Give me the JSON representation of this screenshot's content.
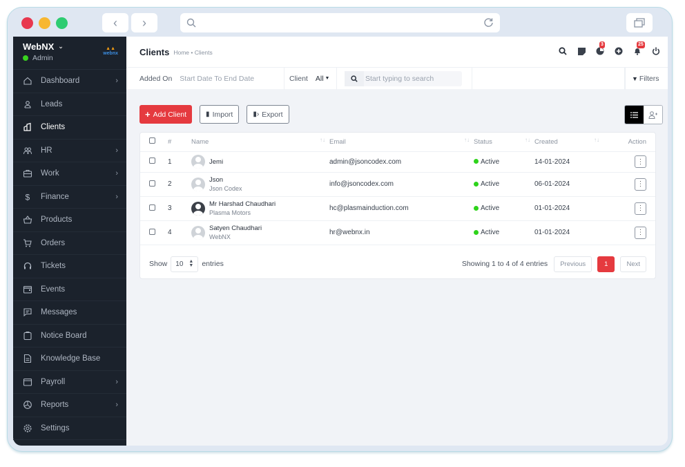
{
  "window": {
    "traffic_lights": {
      "close": "#e8384f",
      "minimize": "#f7b731",
      "maximize": "#2ecc71"
    }
  },
  "sidebar": {
    "brand": "WebNX",
    "role": "Admin",
    "logo_text": "webnx",
    "items": [
      {
        "label": "Dashboard",
        "icon": "home-icon",
        "has_submenu": true
      },
      {
        "label": "Leads",
        "icon": "user-icon",
        "has_submenu": false
      },
      {
        "label": "Clients",
        "icon": "building-icon",
        "has_submenu": false,
        "active": true
      },
      {
        "label": "HR",
        "icon": "users-icon",
        "has_submenu": true
      },
      {
        "label": "Work",
        "icon": "briefcase-icon",
        "has_submenu": true
      },
      {
        "label": "Finance",
        "icon": "dollar-icon",
        "has_submenu": true
      },
      {
        "label": "Products",
        "icon": "basket-icon",
        "has_submenu": false
      },
      {
        "label": "Orders",
        "icon": "cart-icon",
        "has_submenu": false
      },
      {
        "label": "Tickets",
        "icon": "headset-icon",
        "has_submenu": false
      },
      {
        "label": "Events",
        "icon": "calendar-icon",
        "has_submenu": false
      },
      {
        "label": "Messages",
        "icon": "message-icon",
        "has_submenu": false
      },
      {
        "label": "Notice Board",
        "icon": "clipboard-icon",
        "has_submenu": false
      },
      {
        "label": "Knowledge Base",
        "icon": "document-icon",
        "has_submenu": false
      },
      {
        "label": "Payroll",
        "icon": "wallet-icon",
        "has_submenu": true
      },
      {
        "label": "Reports",
        "icon": "pie-chart-icon",
        "has_submenu": true
      },
      {
        "label": "Settings",
        "icon": "gear-icon",
        "has_submenu": false
      }
    ]
  },
  "header": {
    "title": "Clients",
    "breadcrumb": "Home • Clients",
    "badges": {
      "timer": "3",
      "notifications": "25"
    }
  },
  "filters": {
    "added_on_label": "Added On",
    "date_range": "Start Date To End Date",
    "client_label": "Client",
    "client_value": "All",
    "search_placeholder": "Start typing to search",
    "filters_label": "Filters"
  },
  "toolbar": {
    "add_label": "Add Client",
    "import_label": "Import",
    "export_label": "Export"
  },
  "table": {
    "columns": [
      "#",
      "Name",
      "Email",
      "Status",
      "Created",
      "Action"
    ],
    "rows": [
      {
        "num": "1",
        "name": "Jemi",
        "company": "",
        "email": "admin@jsoncodex.com",
        "status": "Active",
        "created": "14-01-2024"
      },
      {
        "num": "2",
        "name": "Json",
        "company": "Json Codex",
        "email": "info@jsoncodex.com",
        "status": "Active",
        "created": "06-01-2024"
      },
      {
        "num": "3",
        "name": "Mr Harshad Chaudhari",
        "company": "Plasma Motors",
        "email": "hc@plasmainduction.com",
        "status": "Active",
        "created": "01-01-2024"
      },
      {
        "num": "4",
        "name": "Satyen Chaudhari",
        "company": "WebNX",
        "email": "hr@webnx.in",
        "status": "Active",
        "created": "01-01-2024"
      }
    ]
  },
  "pagination": {
    "show_label": "Show",
    "page_size": "10",
    "entries_label": "entries",
    "summary": "Showing 1 to 4 of 4 entries",
    "previous": "Previous",
    "current": "1",
    "next": "Next"
  }
}
